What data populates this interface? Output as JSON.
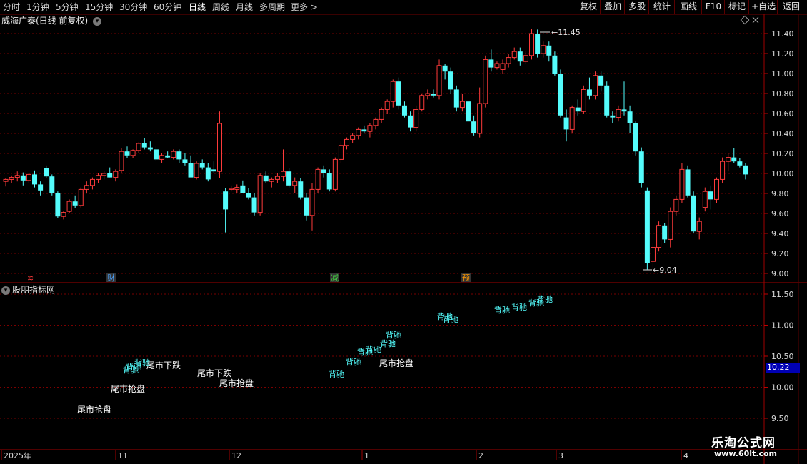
{
  "toolbar": {
    "periods": [
      "分时",
      "1分钟",
      "5分钟",
      "15分钟",
      "30分钟",
      "60分钟",
      "日线",
      "周线",
      "月线",
      "多周期",
      "更多 >"
    ],
    "active_period": "日线",
    "right_buttons": [
      "复权",
      "叠加",
      "多股",
      "统计",
      "画线",
      "F10",
      "标记",
      "+自选",
      "返回"
    ]
  },
  "chart": {
    "title": "威海广泰(日线 前复权)",
    "high_label": "11.45",
    "low_label": "9.04",
    "price_axis": [
      "11.40",
      "11.20",
      "11.00",
      "10.80",
      "10.60",
      "10.40",
      "10.20",
      "10.00",
      "9.80",
      "9.60",
      "9.40",
      "9.20",
      "9.00"
    ],
    "markers": [
      {
        "text": "≋",
        "color": "#ff3b3b"
      },
      {
        "text": "财",
        "color": "#4aa3ff"
      },
      {
        "text": "减",
        "color": "#40d040"
      },
      {
        "text": "预",
        "color": "#ff9900"
      }
    ],
    "colors": {
      "up": "#ff3b3b",
      "down": "#54fcfc",
      "grid": "#7a0000"
    }
  },
  "indicator": {
    "title": "股朋指标网",
    "axis": [
      "11.50",
      "11.00",
      "10.50",
      "10.00",
      "9.50"
    ],
    "current_price": "10.22",
    "signals": [
      {
        "text": "尾市抢盘",
        "color": "#ffffff"
      },
      {
        "text": "尾市抢盘",
        "color": "#ffffff"
      },
      {
        "text": "尾市下跌",
        "color": "#ffffff"
      },
      {
        "text": "尾市下跌",
        "color": "#ffffff"
      },
      {
        "text": "尾市抢盘",
        "color": "#ffffff"
      },
      {
        "text": "尾市抢盘",
        "color": "#ffffff"
      },
      {
        "text": "背驰",
        "color": "#54fcfc"
      }
    ]
  },
  "time_axis": [
    "2025年",
    "11",
    "12",
    "1",
    "2",
    "3",
    "4"
  ],
  "watermark": {
    "name": "乐淘公式网",
    "url": "www.60lt.com"
  }
}
